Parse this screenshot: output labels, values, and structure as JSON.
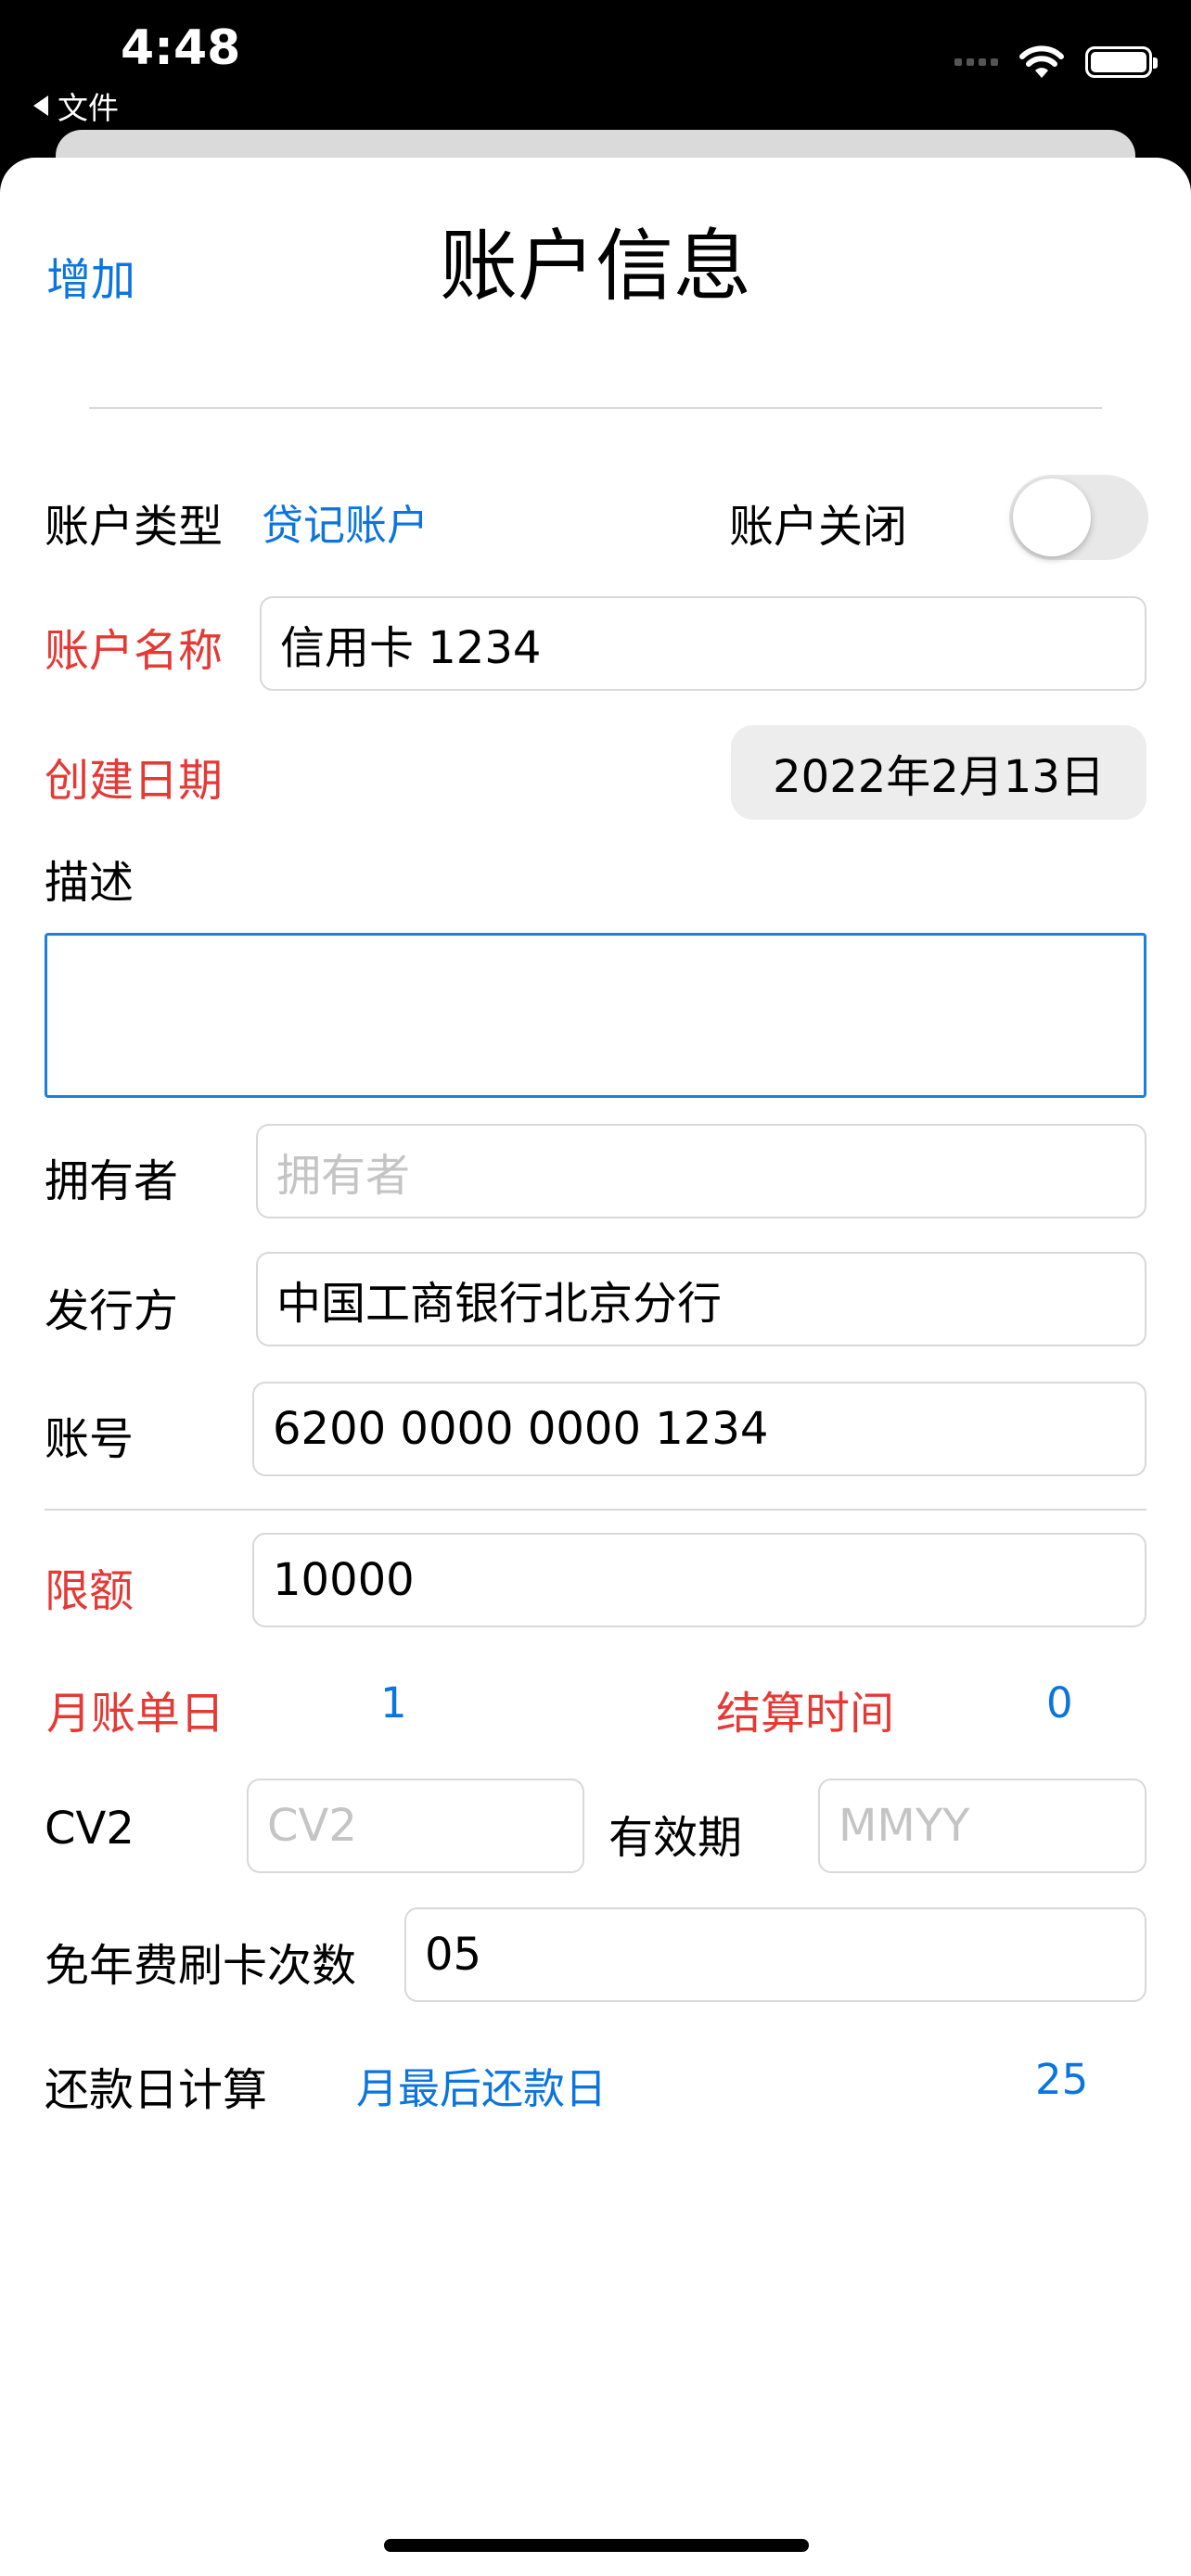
{
  "status_bar": {
    "time": "4:48",
    "back_app": "文件",
    "icons": [
      "cellular-signal-icon",
      "wifi-icon",
      "battery-icon"
    ]
  },
  "header": {
    "add_label": "增加",
    "title": "账户信息"
  },
  "form": {
    "account_type": {
      "label": "账户类型",
      "value": "贷记账户"
    },
    "account_closed": {
      "label": "账户关闭",
      "on": false
    },
    "account_name": {
      "label": "账户名称",
      "value": "信用卡 1234"
    },
    "created_date": {
      "label": "创建日期",
      "value": "2022年2月13日"
    },
    "description": {
      "label": "描述",
      "value": ""
    },
    "owner": {
      "label": "拥有者",
      "placeholder": "拥有者",
      "value": ""
    },
    "issuer": {
      "label": "发行方",
      "value": "中国工商银行北京分行"
    },
    "account_number": {
      "label": "账号",
      "value": "6200 0000 0000 1234"
    },
    "limit": {
      "label": "限额",
      "value": "10000"
    },
    "statement_day": {
      "label": "月账单日",
      "value": "1"
    },
    "settlement_time": {
      "label": "结算时间",
      "value": "0"
    },
    "cv2": {
      "label": "CV2",
      "placeholder": "CV2",
      "value": ""
    },
    "expiry": {
      "label": "有效期",
      "placeholder": "MMYY",
      "value": ""
    },
    "fee_waiver_swipes": {
      "label": "免年费刷卡次数",
      "value": "05"
    },
    "repayment_calc": {
      "label": "还款日计算",
      "option": "月最后还款日",
      "value": "25"
    }
  },
  "colors": {
    "accent_blue": "#0b74de",
    "required_red": "#e53935",
    "focus_border": "#1a7fe0"
  }
}
